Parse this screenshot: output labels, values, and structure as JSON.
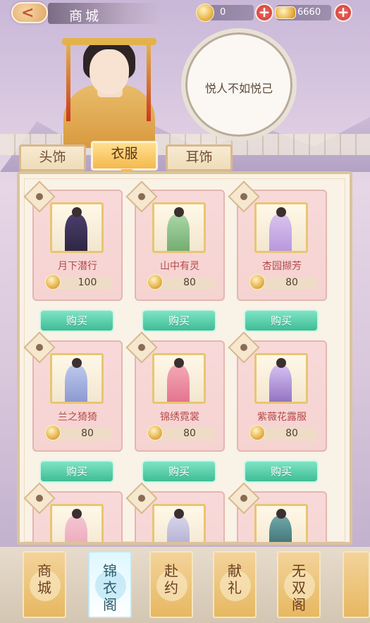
{
  "header": {
    "title": "商城",
    "currency1": {
      "icon": "coin-icon",
      "value": "0"
    },
    "currency2": {
      "icon": "gold-ingot-icon",
      "value": "6660"
    }
  },
  "speech": {
    "text": "悦人不如悦己"
  },
  "tabs": [
    {
      "label": "头饰",
      "active": false
    },
    {
      "label": "衣服",
      "active": true
    },
    {
      "label": "耳饰",
      "active": false
    }
  ],
  "items": [
    {
      "name": "月下潜行",
      "price": "100",
      "color": "#4b3d6b",
      "accent": "#2c2440",
      "buy_label": "购买"
    },
    {
      "name": "山中有灵",
      "price": "80",
      "color": "#a9d7a6",
      "accent": "#6ea86c",
      "buy_label": "购买"
    },
    {
      "name": "杏园撷芳",
      "price": "80",
      "color": "#d9c3ee",
      "accent": "#b593db",
      "buy_label": "购买"
    },
    {
      "name": "兰之猗猗",
      "price": "80",
      "color": "#bcc8ec",
      "accent": "#8795cf",
      "buy_label": "购买"
    },
    {
      "name": "锦绣霓裳",
      "price": "80",
      "color": "#f4a8b6",
      "accent": "#e26f8b",
      "buy_label": "购买"
    },
    {
      "name": "紫薇花露服",
      "price": "80",
      "color": "#d6c1f2",
      "accent": "#8c6bbd",
      "buy_label": "购买"
    },
    {
      "name": "",
      "price": "",
      "color": "#f4c6d1",
      "accent": "#e9a0b3",
      "buy_label": ""
    },
    {
      "name": "",
      "price": "",
      "color": "#d7d5ea",
      "accent": "#a8a2cc",
      "buy_label": ""
    },
    {
      "name": "",
      "price": "",
      "color": "#6fa7a8",
      "accent": "#2f5f66",
      "buy_label": ""
    }
  ],
  "nav": [
    {
      "label": "商\n城",
      "active": false
    },
    {
      "label": "锦\n衣\n阁",
      "active": true
    },
    {
      "label": "赴\n约",
      "active": false
    },
    {
      "label": "献\n礼",
      "active": false
    },
    {
      "label": "无\n双\n阁",
      "active": false
    }
  ]
}
